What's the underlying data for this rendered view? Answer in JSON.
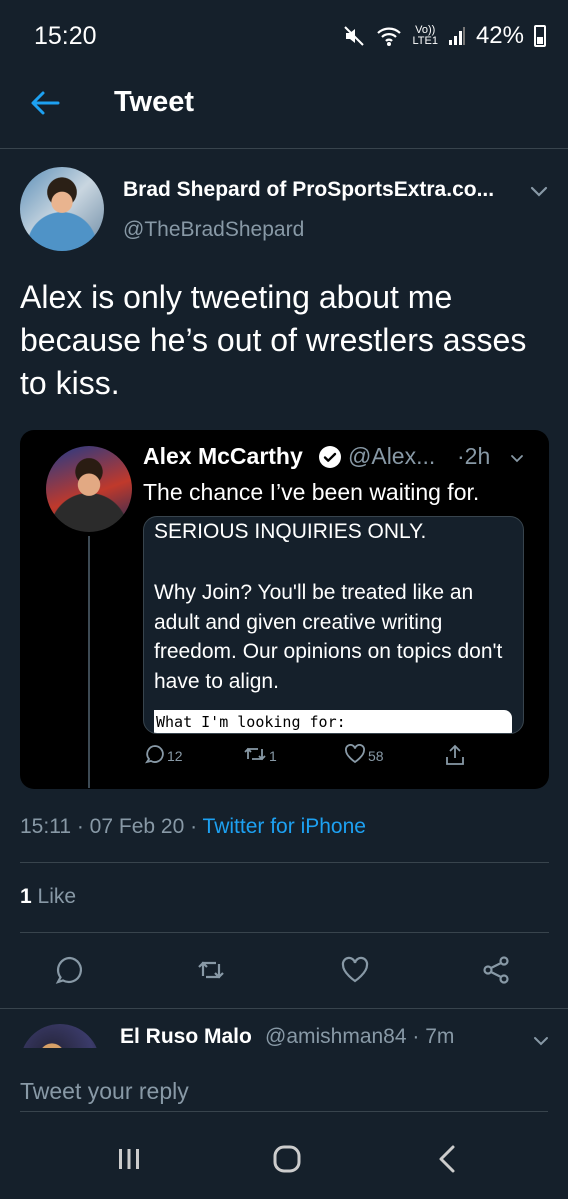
{
  "status_bar": {
    "time": "15:20",
    "volte": "Vo))",
    "lte": "LTE1",
    "battery": "42%"
  },
  "header": {
    "title": "Tweet"
  },
  "tweet": {
    "author_name": "Brad Shepard of ProSportsExtra.co...",
    "author_handle": "@TheBradShepard",
    "text": "Alex is only tweeting about me because he’s out of wrestlers asses to kiss.",
    "quoted": {
      "name": "Alex McCarthy",
      "handle": "@Alex...",
      "time": "·2h",
      "text": "The chance I’ve been waiting for.",
      "image_title": "SERIOUS INQUIRIES ONLY.",
      "image_body": "Why Join?  You'll be treated like an adult and given creative writing freedom.  Our opinions on topics don't have to align.",
      "image_footer": "What I'm looking for:",
      "replies": "12",
      "retweets": "1",
      "likes": "58"
    },
    "time": "15:11",
    "date": "07 Feb 20",
    "source": "Twitter for iPhone",
    "like_count": "1",
    "like_label": "Like"
  },
  "reply_preview": {
    "name": "El Ruso Malo",
    "handle": "@amishman84",
    "time": "7m"
  },
  "reply_box": {
    "placeholder": "Tweet your reply"
  },
  "colors": {
    "background": "#15202b",
    "accent": "#1da1f2",
    "secondary_text": "#8899a6",
    "divider": "#38444d"
  }
}
